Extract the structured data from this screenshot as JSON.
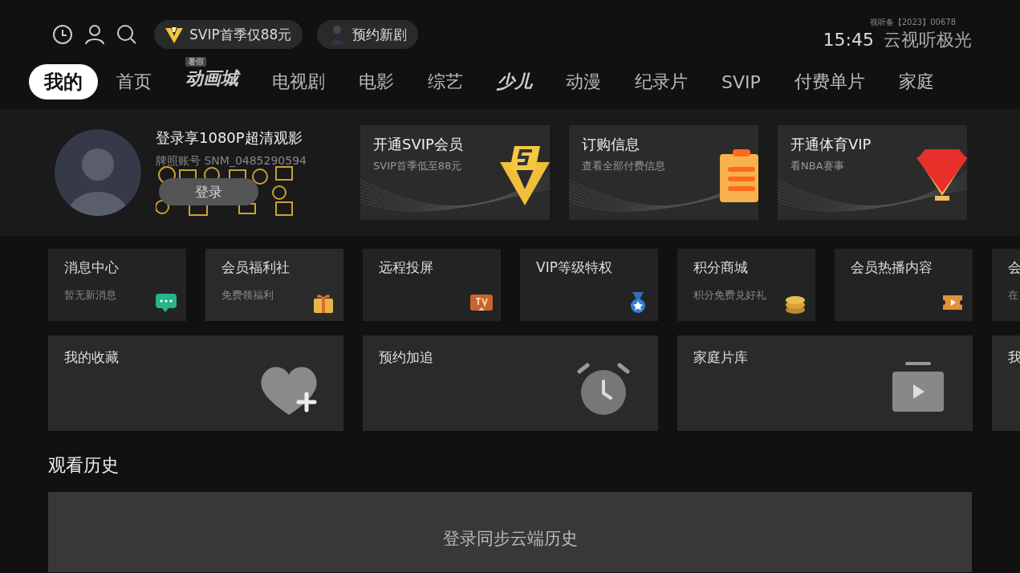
{
  "top_bar": {
    "pills": [
      {
        "kind": "svip",
        "label": "SVIP首季仅88元"
      },
      {
        "kind": "reserve",
        "label": "预约新剧"
      }
    ],
    "license": "视听备【2023】00678",
    "time": "15:45",
    "brand": "云视听极光"
  },
  "nav": {
    "tabs": [
      {
        "label": "我的",
        "kind": "text",
        "selected": true
      },
      {
        "label": "首页",
        "kind": "text",
        "selected": false
      },
      {
        "label": "动画城",
        "kind": "logo",
        "badge": "暑假",
        "selected": false
      },
      {
        "label": "电视剧",
        "kind": "text",
        "selected": false
      },
      {
        "label": "电影",
        "kind": "text",
        "selected": false
      },
      {
        "label": "综艺",
        "kind": "text",
        "selected": false
      },
      {
        "label": "少儿",
        "kind": "logo",
        "selected": false
      },
      {
        "label": "动漫",
        "kind": "text",
        "selected": false
      },
      {
        "label": "纪录片",
        "kind": "text",
        "selected": false
      },
      {
        "label": "SVIP",
        "kind": "text",
        "selected": false
      },
      {
        "label": "付费单片",
        "kind": "text",
        "selected": false
      },
      {
        "label": "家庭",
        "kind": "text",
        "selected": false
      }
    ]
  },
  "profile": {
    "headline": "登录享1080P超清观影",
    "account": "牌照账号 SNM_0485290594",
    "login_button": "登录"
  },
  "promo_cards": [
    {
      "kind": "svip",
      "title": "开通SVIP会员",
      "subtitle": "SVIP首季低至88元"
    },
    {
      "kind": "order",
      "title": "订购信息",
      "subtitle": "查看全部付费信息"
    },
    {
      "kind": "sports",
      "title": "开通体育VIP",
      "subtitle": "看NBA赛事"
    }
  ],
  "shortcuts": [
    {
      "kind": "message",
      "title": "消息中心",
      "subtitle": "暂无新消息"
    },
    {
      "kind": "gift",
      "title": "会员福利社",
      "subtitle": "免费领福利"
    },
    {
      "kind": "cast",
      "title": "远程投屏"
    },
    {
      "kind": "medal",
      "title": "VIP等级特权"
    },
    {
      "kind": "coins",
      "title": "积分商城",
      "subtitle": "积分免费兑好礼"
    },
    {
      "kind": "ticket",
      "title": "会员热播内容"
    },
    {
      "kind": "none",
      "title": "会",
      "subtitle": "在"
    }
  ],
  "library": [
    {
      "kind": "favorite",
      "title": "我的收藏"
    },
    {
      "kind": "alarm",
      "title": "预约加追"
    },
    {
      "kind": "tv",
      "title": "家庭片库"
    },
    {
      "kind": "none",
      "title": "我"
    }
  ],
  "history": {
    "title": "观看历史",
    "prompt": "登录同步云端历史"
  }
}
